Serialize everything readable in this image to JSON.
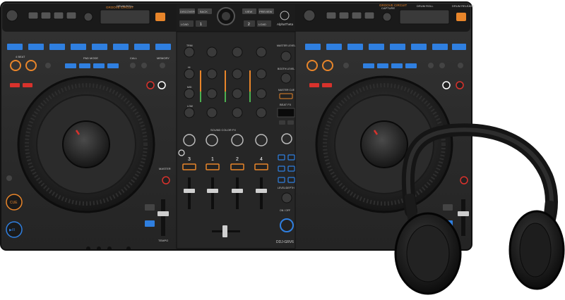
{
  "image": {
    "description_items": [
      "dj-controller",
      "headphones"
    ]
  },
  "controller": {
    "model": "DDJ-GRV6",
    "brand": "AlphaTheta",
    "deck_numbers": [
      "3",
      "1",
      "2",
      "4"
    ],
    "center_labels": {
      "discover": "DISCOVER",
      "back": "BACK",
      "view": "VIEW",
      "preview": "PREVIEW",
      "load_left": "LOAD",
      "load_1": "1",
      "load_2": "2",
      "load_right": "LOAD",
      "master_level": "MASTER LEVEL",
      "booth_level": "BOOTH LEVEL",
      "master_cue": "MASTER CUE",
      "beat_fx": "BEAT FX",
      "level_depth": "LEVEL/DEPTH",
      "sound_color_fx": "SOUND COLOR FX",
      "on_off": "ON / OFF"
    },
    "deck_labels": {
      "groove_circuit": "GROOVE CIRCUIT",
      "drum_roll": "DRUM ROLL",
      "drum_release": "DRUM RELEASE",
      "capture": "CAPTURE",
      "shift": "SHIFT",
      "cue": "CUE",
      "play": "▶/II",
      "sync": "SYNC",
      "master": "MASTER",
      "slip": "SLIP",
      "tempo": "TEMPO",
      "pad_mode": "PAD MODE",
      "call": "CALL",
      "memory": "MEMORY",
      "beat_loop": "4 BEAT",
      "in": "IN",
      "out": "OUT"
    },
    "eq_labels": [
      "TRIM",
      "HI",
      "MID",
      "LOW",
      "CFX"
    ]
  },
  "colors": {
    "chassis": "#2a2a2a",
    "panel": "#1e1e1e",
    "accent_orange": "#e8852a",
    "accent_blue": "#2f7fe0",
    "accent_red": "#d8322c",
    "label_gray": "#cfcfcf"
  }
}
